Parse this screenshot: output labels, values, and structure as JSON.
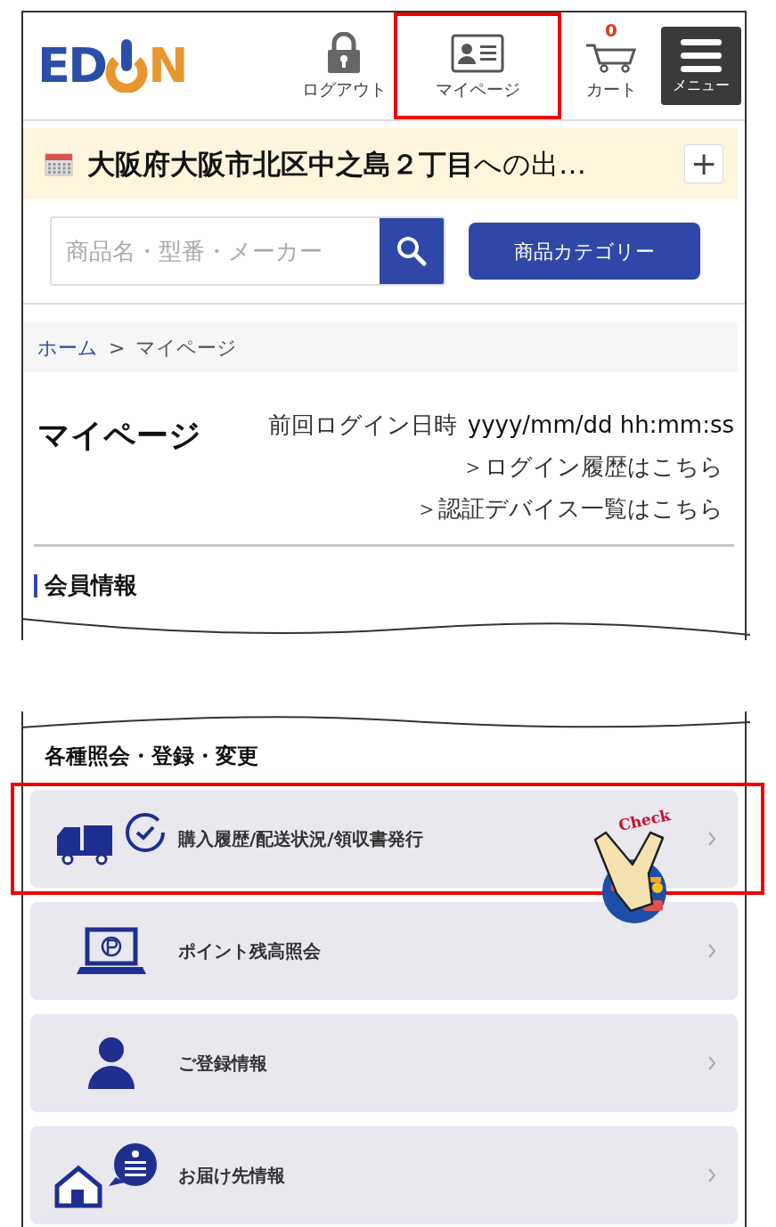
{
  "header": {
    "logo": {
      "left": "ED",
      "right": "N"
    },
    "nav": [
      {
        "kind": "lock",
        "label": "ログアウト",
        "highlighted": false
      },
      {
        "kind": "id-card",
        "label": "マイページ",
        "highlighted": true
      },
      {
        "kind": "cart",
        "label": "カート",
        "badge": "0",
        "highlighted": false
      }
    ],
    "menu_button": {
      "label": "メニュー"
    }
  },
  "delivery": {
    "text": "**大阪府大阪市北区中之島２丁目**への出…",
    "add_button": "+"
  },
  "search": {
    "placeholder": "商品名・型番・メーカー",
    "category_button": "商品カテゴリー"
  },
  "breadcrumb": [
    {
      "label": "ホーム",
      "link": true
    },
    {
      "label": "マイページ",
      "link": false
    }
  ],
  "breadcrumb_separator": ">",
  "mypage": {
    "title": "マイページ",
    "last_login_label": "前回ログイン日時",
    "last_login_value": "yyyy/mm/dd hh:mm:ss",
    "links": [
      "＞ログイン履歴はこちら",
      "＞認証デバイス一覧はこちら"
    ]
  },
  "section_heading": "会員情報",
  "inquiry": {
    "title": "各種照会・登録・変更",
    "items": [
      {
        "kind": "truck-clock",
        "label": "購入履歴/配送状況/領収書発行",
        "highlighted": true
      },
      {
        "kind": "laptop-point",
        "label": "ポイント残高照会",
        "highlighted": false
      },
      {
        "kind": "person",
        "label": "ご登録情報",
        "highlighted": false
      },
      {
        "kind": "house-chat",
        "label": "お届け先情報",
        "highlighted": false
      }
    ]
  },
  "callout": {
    "label": "Check"
  }
}
